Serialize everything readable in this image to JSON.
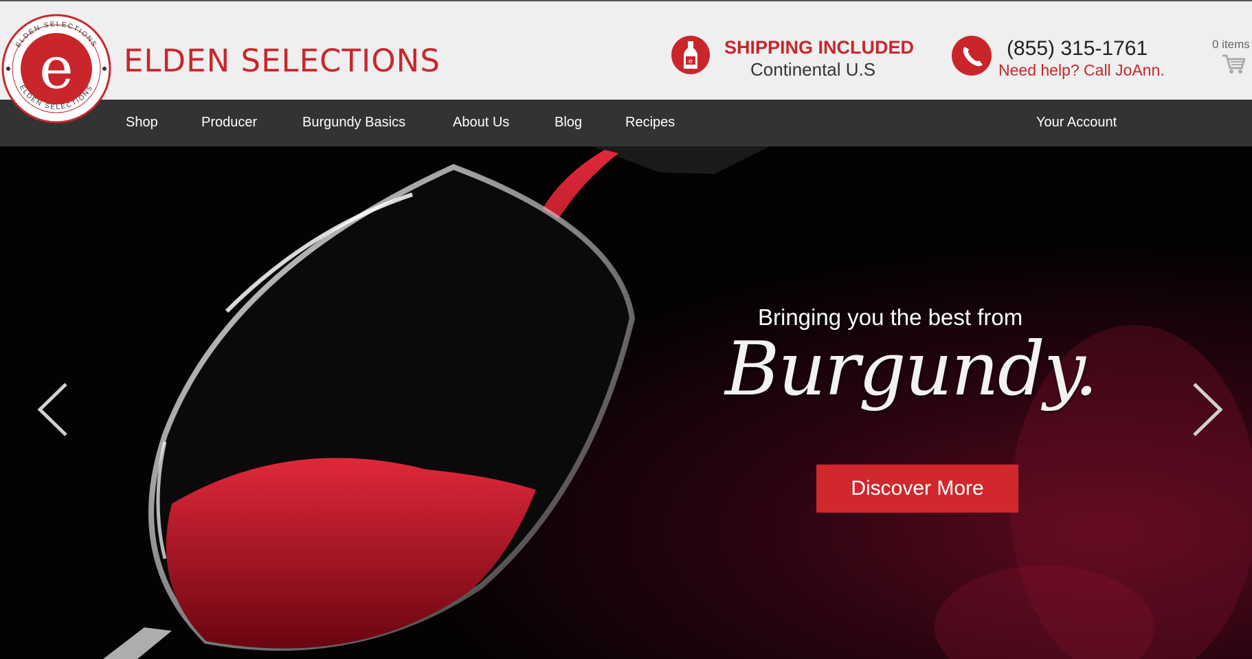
{
  "header": {
    "brand_name": "ELDEN SELECTIONS",
    "logo": {
      "icon": "elden-selections-seal",
      "ring_text": "ELDEN SELECTIONS",
      "letter": "e"
    },
    "shipping": {
      "icon": "wine-bottle-icon",
      "title": "SHIPPING INCLUDED",
      "subtitle": "Continental U.S"
    },
    "contact": {
      "icon": "phone-icon",
      "phone": "(855) 315-1761",
      "help": "Need help? Call JoAnn."
    },
    "cart": {
      "icon": "cart-icon",
      "count_label": "0 items"
    }
  },
  "nav": {
    "items": [
      {
        "label": "Shop"
      },
      {
        "label": "Producer"
      },
      {
        "label": "Burgundy Basics"
      },
      {
        "label": "About Us"
      },
      {
        "label": "Blog"
      },
      {
        "label": "Recipes"
      }
    ],
    "account": "Your Account"
  },
  "hero": {
    "tagline": "Bringing you the best from",
    "script_title": "Burgundy.",
    "button": "Discover More",
    "prev_icon": "chevron-left-icon",
    "next_icon": "chevron-right-icon"
  },
  "colors": {
    "brand_red": "#c8262b",
    "nav_bg": "#333333",
    "header_bg": "#efefef",
    "button_red": "#d0282d"
  }
}
